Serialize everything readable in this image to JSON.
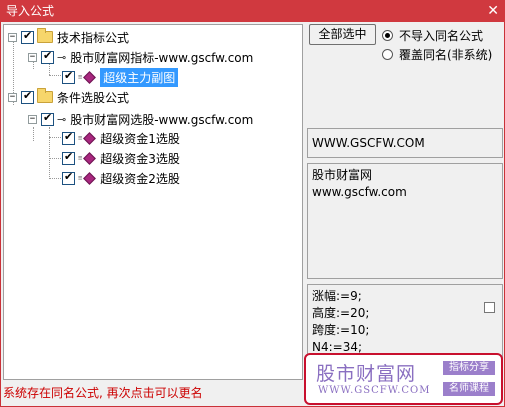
{
  "window": {
    "title": "导入公式",
    "close_label": "✕"
  },
  "tree": {
    "groups": [
      {
        "label": "技术指标公式",
        "child": "股市财富网指标-www.gscfw.com",
        "items": [
          "超级主力副图"
        ]
      },
      {
        "label": "条件选股公式",
        "child": "股市财富网选股-www.gscfw.com",
        "items": [
          "超级资金1选股",
          "超级资金3选股",
          "超级资金2选股"
        ]
      }
    ],
    "expander_symbol": "−"
  },
  "toolbar": {
    "select_all_label": "全部选中"
  },
  "options": {
    "no_import_same_name": "不导入同名公式",
    "overwrite_same_name": "覆盖同名(非系统)",
    "selected": "no_import_same_name"
  },
  "info": {
    "url_box": "WWW.GSCFW.COM",
    "desc_line1": "股市财富网",
    "desc_line2": "www.gscfw.com"
  },
  "code": {
    "lines": [
      "涨幅:=9;",
      "高度:=20;",
      "跨度:=10;",
      "N4:=34;"
    ]
  },
  "status": {
    "message": "系统存在同名公式, 再次点击可以更名"
  },
  "watermark": {
    "brand": "股市财富网",
    "url": "WWW.GSCFW.COM",
    "tag1": "指标分享",
    "tag2": "名师课程"
  },
  "colors": {
    "titlebar": "#d0393f",
    "selection": "#3399ff",
    "status_text": "#cc0000",
    "watermark": "#8a6fc1"
  }
}
